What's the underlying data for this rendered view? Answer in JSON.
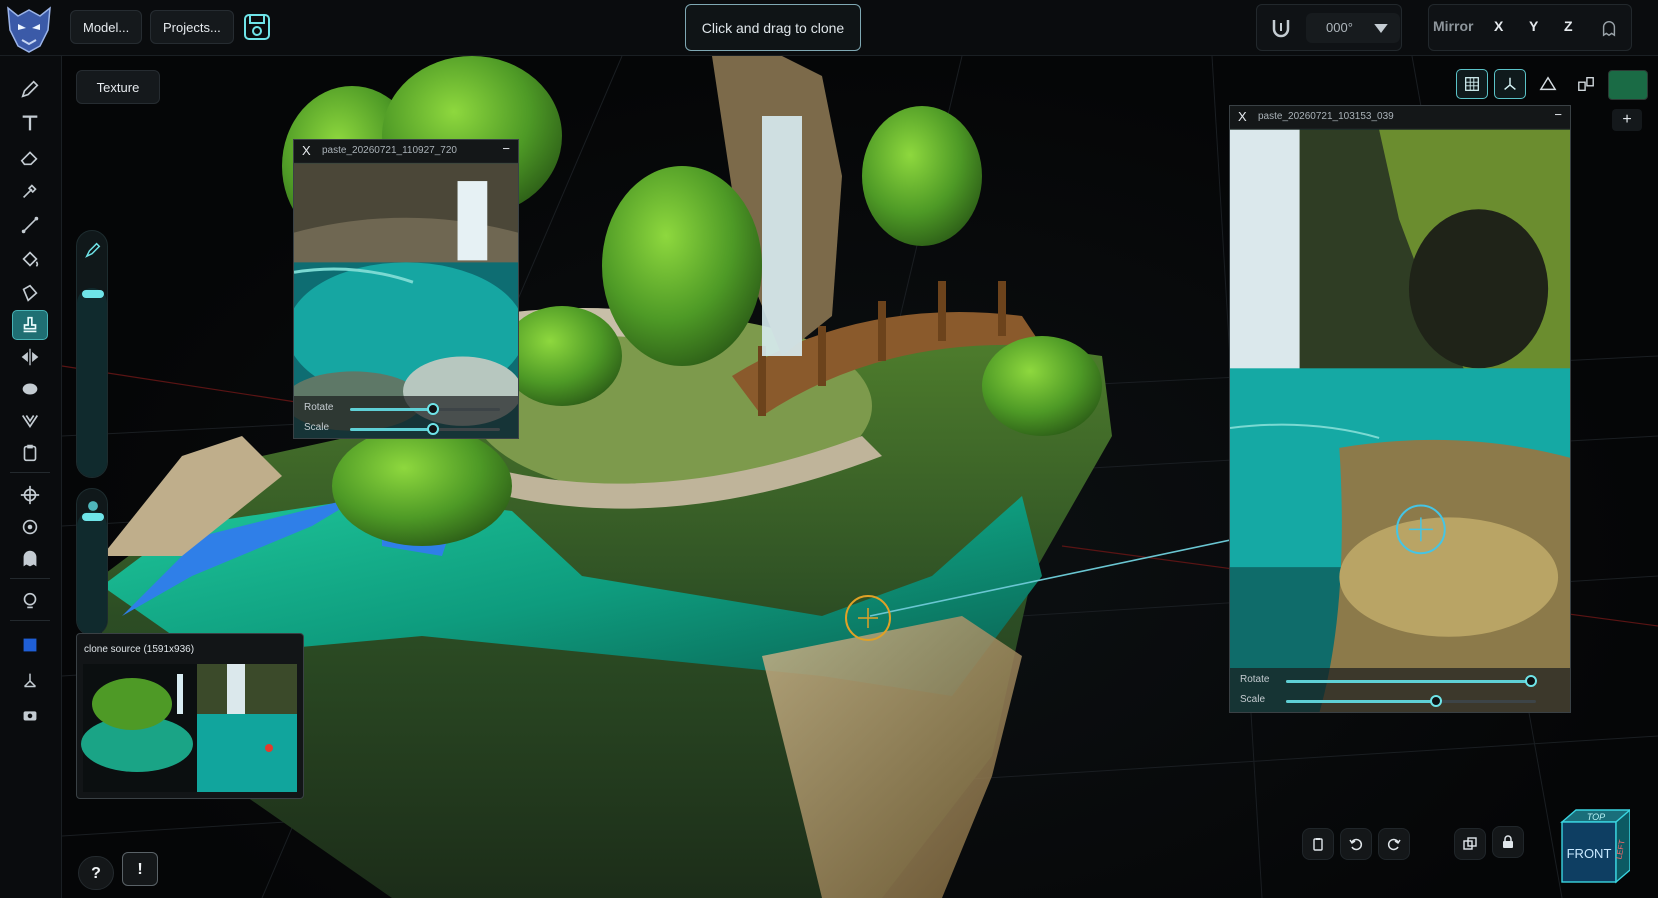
{
  "topbar": {
    "model_label": "Model...",
    "projects_label": "Projects...",
    "hint": "Click and drag to clone",
    "angle": "000°",
    "mirror_label": "Mirror",
    "axes": [
      "X",
      "Y",
      "Z"
    ]
  },
  "texture_label": "Texture",
  "paste_left": {
    "close": "X",
    "title": "paste_20260721_110927_720",
    "minimize": "−",
    "rotate_label": "Rotate",
    "scale_label": "Scale",
    "rotate_value": 0.55,
    "scale_value": 0.55
  },
  "paste_right": {
    "close": "X",
    "title": "paste_20260721_103153_039",
    "minimize": "−",
    "rotate_label": "Rotate",
    "scale_label": "Scale",
    "rotate_value": 0.98,
    "scale_value": 0.6
  },
  "clone_source": {
    "title": "clone source (1591x936)"
  },
  "bottom": {
    "help": "?",
    "alert": "!"
  },
  "navcube": {
    "top": "TOP",
    "front": "FRONT",
    "left": "LEFT"
  },
  "brush_size_value": 0.82,
  "opacity_value": 0.97,
  "colors": {
    "accent": "#5fd0d6",
    "active_tool": "#1f6f73",
    "paint_color": "#1a6b45",
    "clone_target": "#e0a126"
  }
}
